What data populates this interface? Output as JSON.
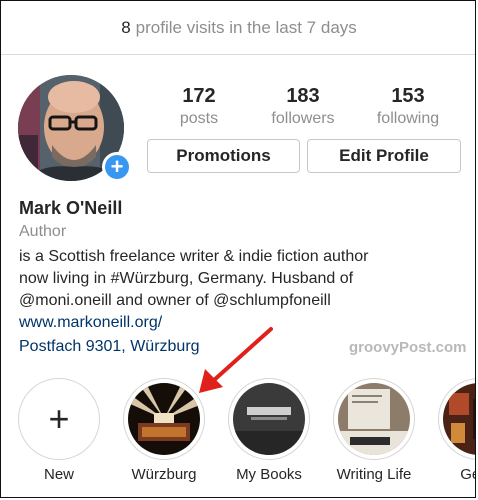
{
  "visits": {
    "count": "8",
    "text": "profile visits in the last 7 days"
  },
  "stats": [
    {
      "value": "172",
      "label": "posts"
    },
    {
      "value": "183",
      "label": "followers"
    },
    {
      "value": "153",
      "label": "following"
    }
  ],
  "buttons": {
    "promotions": "Promotions",
    "edit_profile": "Edit Profile"
  },
  "profile": {
    "name": "Mark O'Neill",
    "category": "Author",
    "bio_lines": [
      "is a Scottish freelance writer & indie fiction author",
      "now living in #Würzburg, Germany. Husband of",
      "@moni.oneill and owner of @schlumpfoneill"
    ],
    "website": "www.markoneill.org/",
    "address": "Postfach 9301, Würzburg"
  },
  "watermark": "groovyPost.com",
  "highlights": [
    {
      "label": "New",
      "icon": "plus-icon"
    },
    {
      "label": "Würzburg"
    },
    {
      "label": "My Books"
    },
    {
      "label": "Writing Life"
    },
    {
      "label": "Germ"
    }
  ],
  "colors": {
    "accent": "#3897f0",
    "link": "#003569",
    "arrow": "#e0201b"
  }
}
